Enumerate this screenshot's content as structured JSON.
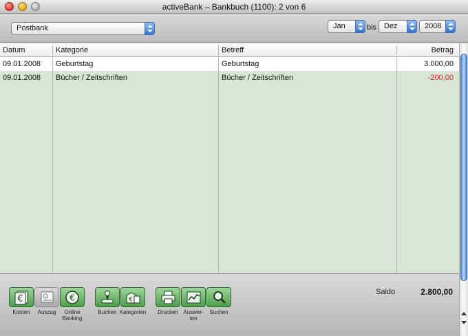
{
  "window": {
    "title": "activeBank – Bankbuch (1100): 2 von 6"
  },
  "filters": {
    "account": "Postbank",
    "from_month": "Jan",
    "bis_label": "bis",
    "to_month": "Dez",
    "year": "2008"
  },
  "table": {
    "columns": {
      "datum": "Datum",
      "kategorie": "Kategorie",
      "betreff": "Betreff",
      "betrag": "Betrag"
    },
    "rows": [
      {
        "datum": "09.01.2008",
        "kategorie": "Geburtstag",
        "betreff": "Geburtstag",
        "betrag": "3.000,00",
        "negative": false
      },
      {
        "datum": "09.01.2008",
        "kategorie": "Bücher / Zeitschriften",
        "betreff": "Bücher / Zeitschriften",
        "betrag": "-200,00",
        "negative": true
      }
    ]
  },
  "toolbar": {
    "konten": "Konten",
    "auszug": "Auszug",
    "online_banking_1": "Online",
    "online_banking_2": "Banking",
    "buchen": "Buchen",
    "kategorien": "Kategorien",
    "drucken": "Drucken",
    "auswerten_1": "Auswer-",
    "auswerten_2": "ten",
    "suchen": "Suchen"
  },
  "saldo": {
    "label": "Saldo",
    "value": "2.800,00"
  },
  "colors": {
    "row_green": "#d7e6d5",
    "negative": "#d81e1e",
    "button_green": "#4f9e4d",
    "accent_blue": "#2f73d1"
  }
}
